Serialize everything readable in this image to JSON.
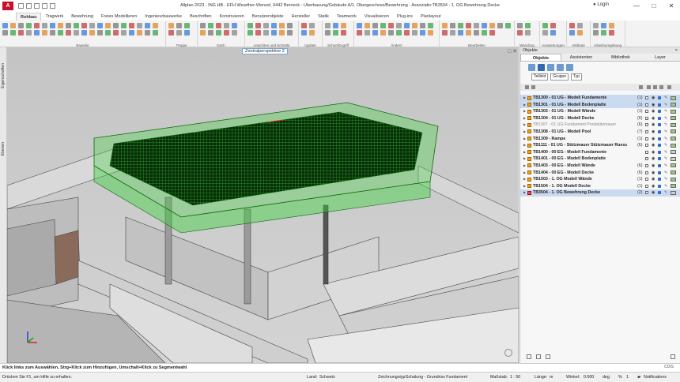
{
  "app": {
    "title": "Allplan 2023 - ING HB - EFH Wearther-Wenzel, 9442 Berneck - Überbauung/Gebäude A/1. Obergeschoss/Bewehrung - Assoziativ:TB3504 - 1. OG  Bewehrung Decke",
    "login_label": "Login",
    "logo_text": "A"
  },
  "ribbon_tabs": [
    "Rohbau",
    "Tragwerk",
    "Bewehrung",
    "Freies Modellieren",
    "Ingenieurbauwerke",
    "Beschriften",
    "Konstruieren",
    "Benutzerobjekte",
    "Hersteller",
    "Statik",
    "Teamwork",
    "Visualisieren",
    "Plug-ins",
    "Planlayout"
  ],
  "ribbon_groups": [
    "Bauteile",
    "Treppe",
    "Dach",
    "Ansichten und Schnitte",
    "Update",
    "Schnellzugriff",
    "Ändern",
    "Bearbeiten",
    "Wandzug",
    "Auswertungen",
    "Attribute",
    "Arbeitsumgebung"
  ],
  "left_dock": {
    "tab1": "Eigenschaften",
    "tab2": "Ebenen"
  },
  "viewport": {
    "title": "Zentralperspektive 2"
  },
  "panel": {
    "title": "Objekte",
    "tabs": [
      "Objekte",
      "Assistenten",
      "Bibliothek",
      "Layer"
    ],
    "filters": [
      "Teilbild",
      "Gruppe",
      "Typ"
    ],
    "close_glyph": "×"
  },
  "tree_items": [
    {
      "name": "TB1300 - 01 UG  -  Modell Fundamente",
      "count": "(1)",
      "highlight": true,
      "dim": false,
      "red": false,
      "color": "green"
    },
    {
      "name": "TB1301 - 01 UG  -  Modell Bodenplatte",
      "count": "(1)",
      "highlight": true,
      "dim": false,
      "red": false,
      "color": "green"
    },
    {
      "name": "TB1303 - 01 UG  -  Modell Wände",
      "count": "(1)",
      "highlight": false,
      "dim": false,
      "red": false,
      "color": "green"
    },
    {
      "name": "TB1304 - 01 UG  -  Modell Decke",
      "count": "(6)",
      "highlight": false,
      "dim": false,
      "red": false,
      "color": "green"
    },
    {
      "name": "TB1307 - 01 UG Fundament Poolstützmauer",
      "count": "(6)",
      "highlight": false,
      "dim": true,
      "red": false,
      "color": "green"
    },
    {
      "name": "TB1308 - 01 UG  -  Modell Pool",
      "count": "(7)",
      "highlight": false,
      "dim": false,
      "red": false,
      "color": "green"
    },
    {
      "name": "TB1309 - Rampe",
      "count": "(1)",
      "highlight": false,
      "dim": false,
      "red": false,
      "color": "green"
    },
    {
      "name": "TB1111 - 01 UG  -  Stützmauer Stützmauer Ruess",
      "count": "(6)",
      "highlight": false,
      "dim": false,
      "red": false,
      "color": "green"
    },
    {
      "name": "TB1400 - 00 EG  -  Modell Fundamente",
      "count": "",
      "highlight": false,
      "dim": false,
      "red": false,
      "color": "grey"
    },
    {
      "name": "TB1401 - 00 EG  -  Modell Bodenplatte",
      "count": "",
      "highlight": false,
      "dim": false,
      "red": false,
      "color": "grey"
    },
    {
      "name": "TB1403 - 00 EG  -  Modell Wände",
      "count": "(6)",
      "highlight": false,
      "dim": false,
      "red": false,
      "color": "green"
    },
    {
      "name": "TB1404 - 00 EG  -  Modell Decke",
      "count": "(6)",
      "highlight": false,
      "dim": false,
      "red": false,
      "color": "green"
    },
    {
      "name": "TB1503 - 1. OG  Modell Wände",
      "count": "(1)",
      "highlight": false,
      "dim": false,
      "red": false,
      "color": "green"
    },
    {
      "name": "TB1504 - 1. OG  Modell Decke",
      "count": "(1)",
      "highlight": false,
      "dim": false,
      "red": false,
      "color": "green"
    },
    {
      "name": "TB3504 - 1. OG  Bewehrung Decke",
      "count": "(2)",
      "highlight": true,
      "dim": false,
      "red": true,
      "color": "grey"
    }
  ],
  "prompt": "Klick links zum Auswählen, Strg+Klick zum Hinzufügen, Umschalt+Klick zu Segmentwahl",
  "status": {
    "help": "Drücken Sie F1, um Hilfe zu erhalten.",
    "land_label": "Land:",
    "land_value": "Schweiz",
    "drawing_type_label": "Zeichnungstyp:",
    "drawing_type_value": "Schalung - Grundriss Fundament",
    "scale_label": "Maßstab:",
    "scale_value": "1 : 50",
    "length_label": "Länge:",
    "length_value": "m",
    "angle_label": "Winkel:",
    "angle_value": "0.000",
    "deg_value": "deg",
    "percent_value": "%",
    "percent_num": "1",
    "notifications": "Notifications"
  },
  "vendor_mark": "CDIS",
  "colors": {
    "accent_blue": "#3468b0",
    "reinforcement_green": "#1fb81f",
    "highlight_row": "#c9daf1"
  }
}
